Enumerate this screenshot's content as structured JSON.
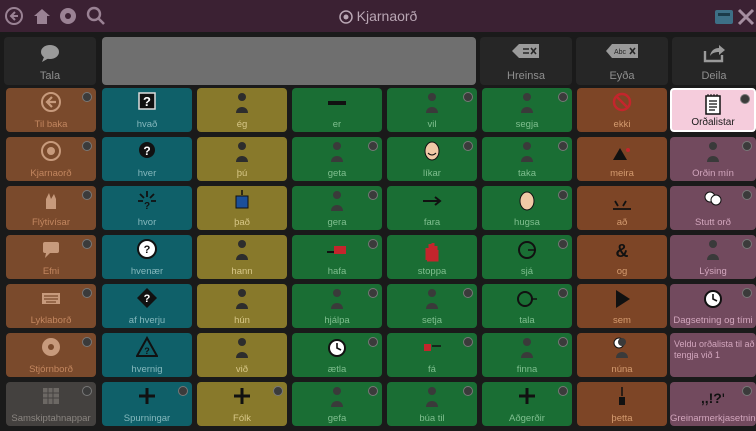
{
  "app": {
    "title": "Kjarnaorð"
  },
  "toolbar": {
    "tala_label": "Tala",
    "hreinsa_label": "Hreinsa",
    "eyda_label": "Eyða",
    "deila_label": "Deila",
    "eyda_icon_text": "Abc"
  },
  "nav": [
    {
      "label": "Til baka",
      "icon": "arrow-left-circle-icon"
    },
    {
      "label": "Kjarnaorð",
      "icon": "core-words-icon"
    },
    {
      "label": "Flýtivísar",
      "icon": "shortcut-hand-icon"
    },
    {
      "label": "Efni",
      "icon": "speech-topic-icon"
    },
    {
      "label": "Lyklaborð",
      "icon": "keyboard-icon"
    },
    {
      "label": "Stjórnborð",
      "icon": "settings-dial-icon"
    },
    {
      "label": "Samskiptahnappar",
      "icon": "grid-icon"
    }
  ],
  "grid": {
    "col1": [
      "hvað",
      "hver",
      "hvor",
      "hvenær",
      "af hverju",
      "hvernig",
      "Spurningar"
    ],
    "col2": [
      "ég",
      "þú",
      "það",
      "hann",
      "hún",
      "við",
      "Fólk"
    ],
    "col3": [
      "er",
      "geta",
      "gera",
      "hafa",
      "hjálpa",
      "ætla",
      "gefa"
    ],
    "col4": [
      "vil",
      "líkar",
      "fara",
      "stoppa",
      "setja",
      "fá",
      "búa til"
    ],
    "col5": [
      "segja",
      "taka",
      "hugsa",
      "sjá",
      "tala",
      "finna",
      "Aðgerðir"
    ],
    "col6": [
      "ekki",
      "meira",
      "að",
      "og",
      "sem",
      "núna",
      "þetta"
    ],
    "col7": [
      "Orðalistar",
      "Orðin mín",
      "Stutt orð",
      "Lýsing",
      "Dagsetning og tími",
      "Veldu orðalista til að tengja við 1",
      "Greinarmerkjasetning"
    ]
  },
  "symbols": {
    "question_mark": "?",
    "ampersand": "&",
    "punct": ",,!?'",
    "plus": "+"
  },
  "colors": {
    "topbar": "#3b2133",
    "teal": "#0f6069",
    "yellow": "#88792b",
    "green": "#1a6e34",
    "orange": "#7d4526",
    "pink": "#724a5e",
    "selected": "#f5ccdc"
  }
}
